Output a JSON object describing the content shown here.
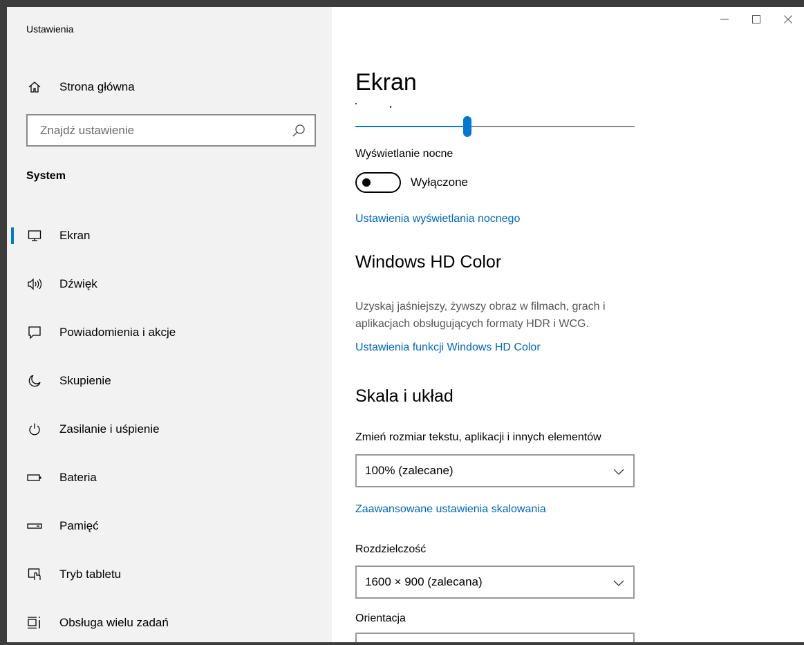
{
  "app": {
    "title": "Ustawienia"
  },
  "sidebar": {
    "home_label": "Strona główna",
    "search": {
      "placeholder": "Znajdź ustawienie"
    },
    "section": "System",
    "items": [
      {
        "label": "Ekran",
        "icon": "monitor-icon"
      },
      {
        "label": "Dźwięk",
        "icon": "speaker-icon"
      },
      {
        "label": "Powiadomienia i akcje",
        "icon": "notification-icon"
      },
      {
        "label": "Skupienie",
        "icon": "moon-icon"
      },
      {
        "label": "Zasilanie i uśpienie",
        "icon": "power-icon"
      },
      {
        "label": "Bateria",
        "icon": "battery-icon"
      },
      {
        "label": "Pamięć",
        "icon": "storage-icon"
      },
      {
        "label": "Tryb tabletu",
        "icon": "tablet-icon"
      },
      {
        "label": "Obsługa wielu zadań",
        "icon": "multitasking-icon"
      }
    ],
    "selected_index": 0
  },
  "main": {
    "title": "Ekran",
    "brightness_slider": {
      "value": 40
    },
    "night_light": {
      "label": "Wyświetlanie nocne",
      "toggle_state": "Wyłączone",
      "link": "Ustawienia wyświetlania nocnego"
    },
    "hd_color": {
      "heading": "Windows HD Color",
      "description": "Uzyskaj jaśniejszy, żywszy obraz w filmach, grach i aplikacjach obsługujących formaty HDR i WCG.",
      "link": "Ustawienia funkcji Windows HD Color"
    },
    "scale_layout": {
      "heading": "Skala i układ",
      "scale_label": "Zmień rozmiar tekstu, aplikacji i innych elementów",
      "scale_value": "100% (zalecane)",
      "advanced_link": "Zaawansowane ustawienia skalowania",
      "resolution_label": "Rozdzielczość",
      "resolution_value": "1600 × 900 (zalecana)",
      "orientation_label": "Orientacja"
    }
  },
  "colors": {
    "accent": "#0078d4",
    "link": "#0067c0",
    "sidebar_bg": "#f2f2f2"
  }
}
